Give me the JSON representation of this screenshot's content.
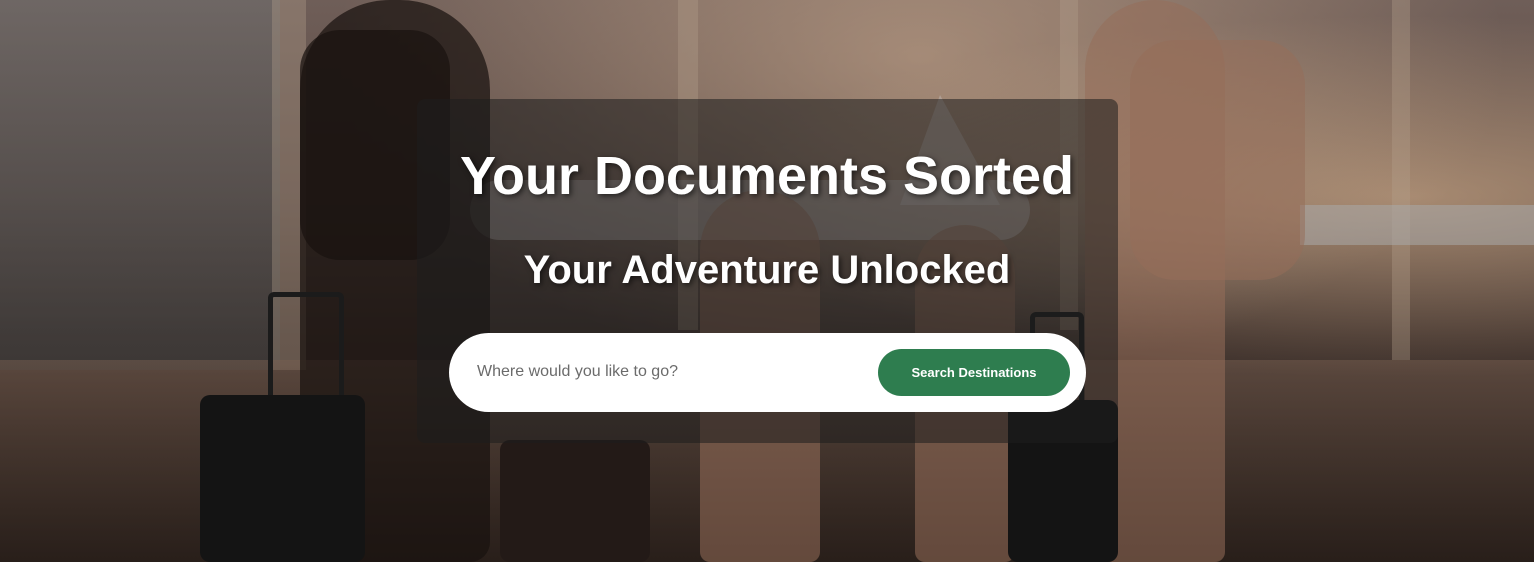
{
  "hero": {
    "title": "Your Documents Sorted",
    "subtitle": "Your Adventure Unlocked",
    "background_image": "family-with-luggage-at-airport-photo"
  },
  "search": {
    "placeholder": "Where would you like to go?",
    "value": "",
    "button_label": "Search Destinations"
  },
  "colors": {
    "accent": "#2e7d4f",
    "heading_text": "#ffffff",
    "panel_overlay": "rgba(30,30,30,0.55)"
  }
}
